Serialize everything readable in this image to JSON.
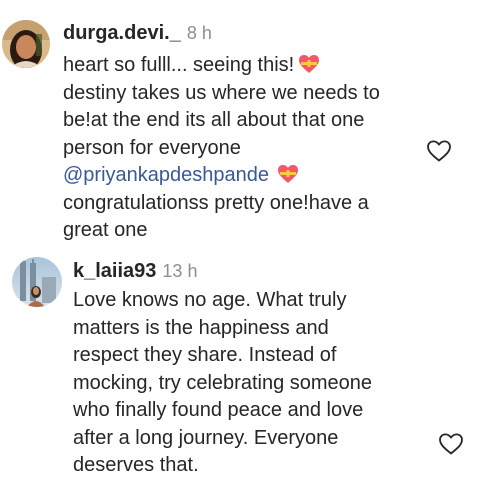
{
  "comments": [
    {
      "username": "durga.devi._",
      "time": "8 h",
      "lines": [
        "heart so fulll... seeing this!",
        "destiny takes us where we needs to",
        "be!at the end its all about that one",
        "person for everyone",
        "@priyankapdeshpande",
        "congratulationss pretty one!have a",
        "great one"
      ],
      "emojis": [
        "heart-with-ribbon-icon",
        "heart-with-ribbon-icon"
      ],
      "like_icon": "heart-outline-icon"
    },
    {
      "username": "k_laiia93",
      "time": "13 h",
      "lines": [
        "Love knows no age. What truly",
        "matters is the happiness and",
        "respect they share. Instead of",
        "mocking, try celebrating someone",
        "who finally found peace and love",
        "after a long journey. Everyone",
        "deserves that."
      ],
      "like_icon": "heart-outline-icon"
    }
  ],
  "colors": {
    "text": "#262626",
    "secondary": "#8e8e8e",
    "mention": "#385898",
    "emoji_heart": "#f5566c",
    "emoji_ribbon": "#ffc93c"
  }
}
